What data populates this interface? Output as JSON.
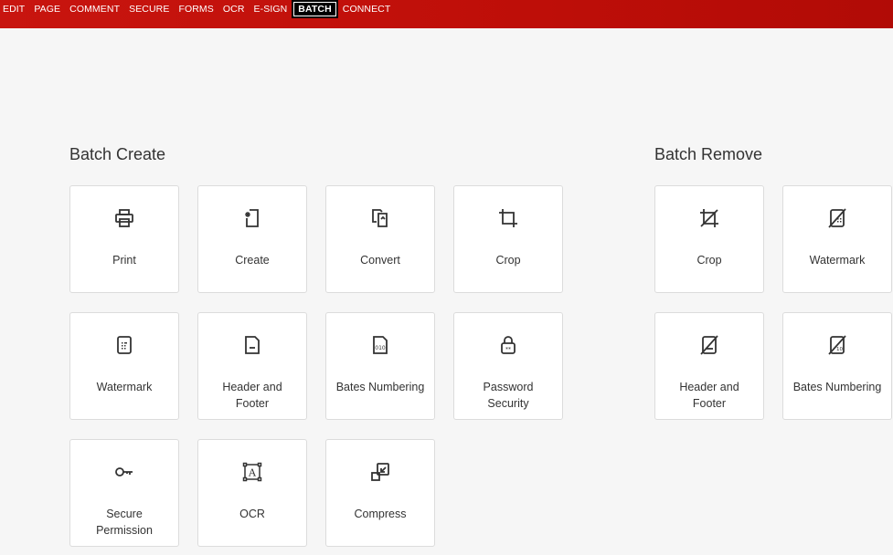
{
  "menu": {
    "tabs": [
      {
        "label": "EDIT"
      },
      {
        "label": "PAGE"
      },
      {
        "label": "COMMENT"
      },
      {
        "label": "SECURE"
      },
      {
        "label": "FORMS"
      },
      {
        "label": "OCR"
      },
      {
        "label": "E-SIGN"
      },
      {
        "label": "BATCH",
        "active": true
      },
      {
        "label": "CONNECT"
      }
    ]
  },
  "batch_create": {
    "title": "Batch Create",
    "items": [
      {
        "label": "Print",
        "icon": "printer-icon"
      },
      {
        "label": "Create",
        "icon": "create-file-icon"
      },
      {
        "label": "Convert",
        "icon": "convert-icon"
      },
      {
        "label": "Crop",
        "icon": "crop-icon"
      },
      {
        "label": "Watermark",
        "icon": "watermark-icon"
      },
      {
        "label": "Header and\nFooter",
        "icon": "header-footer-icon"
      },
      {
        "label": "Bates Numbering",
        "icon": "bates-numbering-icon"
      },
      {
        "label": "Password\nSecurity",
        "icon": "password-lock-icon"
      },
      {
        "label": "Secure\nPermission",
        "icon": "key-icon"
      },
      {
        "label": "OCR",
        "icon": "ocr-icon"
      },
      {
        "label": "Compress",
        "icon": "compress-icon"
      }
    ]
  },
  "batch_remove": {
    "title": "Batch Remove",
    "items": [
      {
        "label": "Crop",
        "icon": "remove-crop-icon"
      },
      {
        "label": "Watermark",
        "icon": "remove-watermark-icon"
      },
      {
        "label": "Header and\nFooter",
        "icon": "remove-header-footer-icon"
      },
      {
        "label": "Bates Numbering",
        "icon": "remove-bates-numbering-icon"
      }
    ]
  },
  "colors": {
    "topbar": "#c8150f",
    "background": "#f6f6f6",
    "card": "#ffffff",
    "icon": "#333333"
  }
}
